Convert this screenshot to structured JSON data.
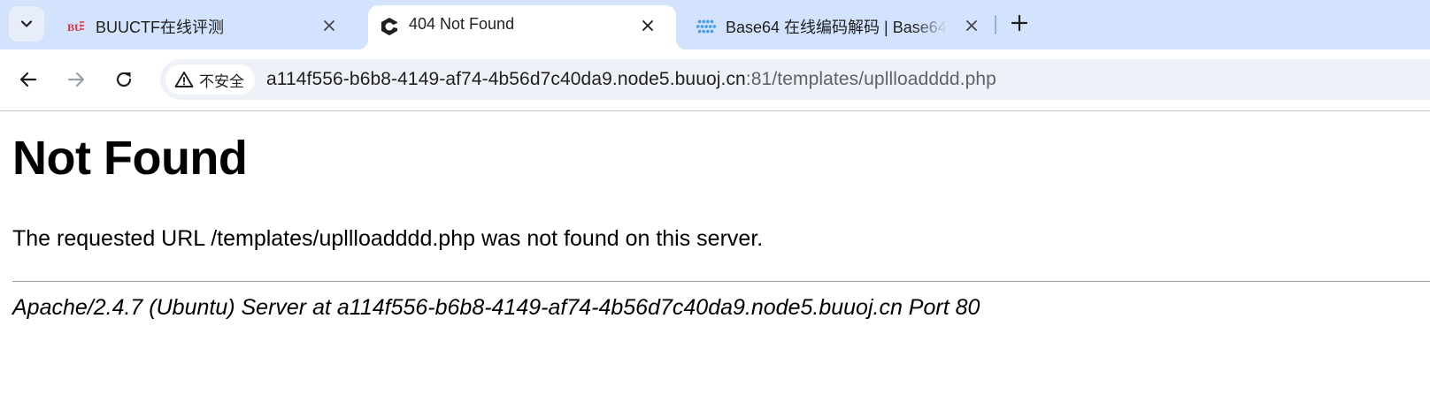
{
  "tabs": [
    {
      "title": "BUUCTF在线评测",
      "favicon": "buuctf-logo-icon",
      "active": false
    },
    {
      "title": "404 Not Found",
      "favicon": "site-logo-icon",
      "active": true
    },
    {
      "title": "Base64 在线编码解码 | Base64",
      "favicon": "base64-logo-icon",
      "active": false
    }
  ],
  "toolbar": {
    "security_chip": "不安全",
    "url_host": "a114f556-b6b8-4149-af74-4b56d7c40da9.node5.buuoj.cn",
    "url_rest": ":81/templates/upllloadddd.php"
  },
  "page": {
    "heading": "Not Found",
    "message": "The requested URL /templates/upllloadddd.php was not found on this server.",
    "address": "Apache/2.4.7 (Ubuntu) Server at a114f556-b6b8-4149-af74-4b56d7c40da9.node5.buuoj.cn Port 80"
  },
  "colors": {
    "tabstrip_bg": "#d3e3fd",
    "omnibox_bg": "#eef1f8",
    "buuctf_red": "#d6344a",
    "base64_blue": "#4a9fe0"
  }
}
